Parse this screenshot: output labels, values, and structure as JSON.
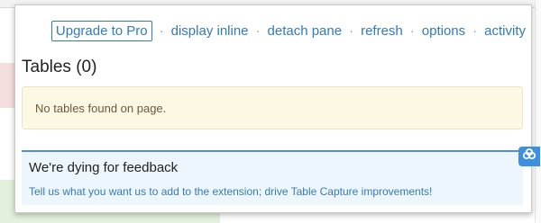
{
  "toolbar": {
    "upgrade_label": "Upgrade to Pro",
    "separator": "·",
    "links": [
      "display inline",
      "detach pane",
      "refresh",
      "options",
      "activity"
    ]
  },
  "tables": {
    "heading": "Tables (0)",
    "empty_message": "No tables found on page."
  },
  "feedback": {
    "title": "We're dying for feedback",
    "link_text": "Tell us what you want us to add to the extension; drive Table Capture improvements!"
  },
  "side_tab": {
    "icon": "cloud-connect-icon"
  },
  "colors": {
    "link": "#337ab7",
    "notice_bg": "#fcf8e3",
    "feedback_bg": "#eef6fd",
    "feedback_border": "#4f8fd6",
    "side_tab": "#3d8fe0"
  }
}
